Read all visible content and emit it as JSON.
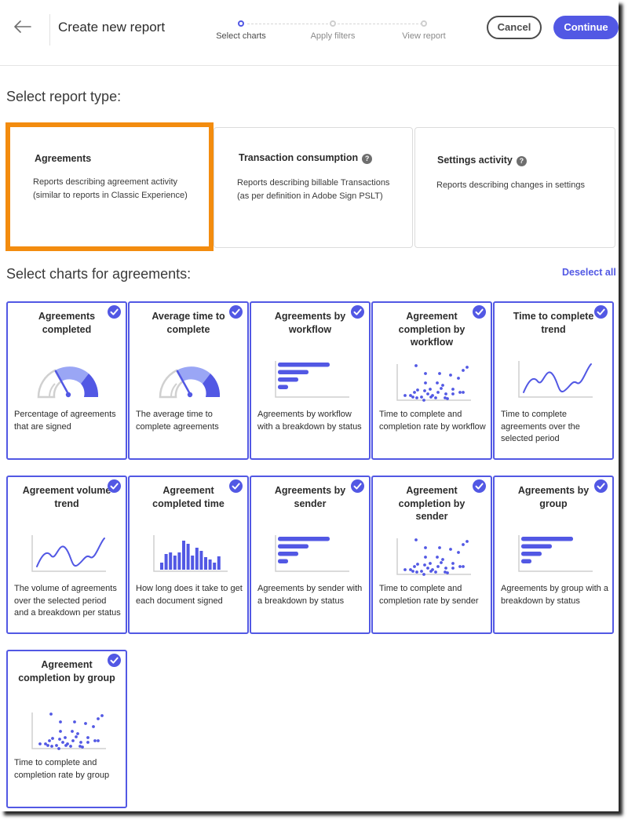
{
  "header": {
    "title": "Create new report",
    "back_icon": "arrow-left-icon",
    "steps": [
      {
        "label": "Select charts",
        "active": true
      },
      {
        "label": "Apply filters",
        "active": false
      },
      {
        "label": "View report",
        "active": false
      }
    ],
    "cancel_label": "Cancel",
    "continue_label": "Continue"
  },
  "colors": {
    "accent": "#5258e4",
    "accent_light": "#9aa6f5",
    "selection_highlight": "#f38c0f",
    "gauge_track": "#d0d0d0"
  },
  "report_type": {
    "heading": "Select report type:",
    "options": [
      {
        "title": "Agreements",
        "description_lines": [
          "Reports describing agreement activity",
          "(similar to reports in Classic Experience)"
        ],
        "help": false,
        "selected": true
      },
      {
        "title": "Transaction consumption",
        "description_lines": [
          "Reports describing billable Transactions",
          "(as per definition in Adobe Sign PSLT)"
        ],
        "help": true,
        "selected": false
      },
      {
        "title": "Settings activity",
        "description_lines": [
          "Reports describing changes in settings"
        ],
        "help": true,
        "selected": false
      }
    ],
    "help_glyph": "?"
  },
  "charts": {
    "heading": "Select charts for agreements:",
    "deselect_all_label": "Deselect all",
    "items": [
      {
        "title": "Agreements completed",
        "description": "Percentage of agreements that are signed",
        "thumbnail": "gauge",
        "checked": true
      },
      {
        "title": "Average time to complete",
        "description": "The average time to complete agreements",
        "thumbnail": "gauge",
        "checked": true
      },
      {
        "title": "Agreements by workflow",
        "description": "Agreements by workflow with a breakdown by status",
        "thumbnail": "hbar",
        "checked": true
      },
      {
        "title": "Agreement completion by workflow",
        "description": "Time to complete and completion rate by workflow",
        "thumbnail": "scatter",
        "checked": true
      },
      {
        "title": "Time to complete trend",
        "description": "Time to complete agreements over the selected period",
        "thumbnail": "line",
        "checked": true
      },
      {
        "title": "Agreement volume trend",
        "description": "The volume of agreements over the selected period and a breakdown per status",
        "thumbnail": "line",
        "checked": true
      },
      {
        "title": "Agreement completed time",
        "description": "How long does it take to get each document signed",
        "thumbnail": "histogram",
        "checked": true
      },
      {
        "title": "Agreements by sender",
        "description": "Agreements by sender with a breakdown by status",
        "thumbnail": "hbar",
        "checked": true
      },
      {
        "title": "Agreement completion by sender",
        "description": "Time to complete and completion rate by sender",
        "thumbnail": "scatter",
        "checked": true
      },
      {
        "title": "Agreements by group",
        "description": "Agreements by group with a breakdown by status",
        "thumbnail": "hbar",
        "checked": true
      },
      {
        "title": "Agreement completion by group",
        "description": "Time to complete and completion rate by group",
        "thumbnail": "scatter",
        "checked": true
      }
    ]
  }
}
